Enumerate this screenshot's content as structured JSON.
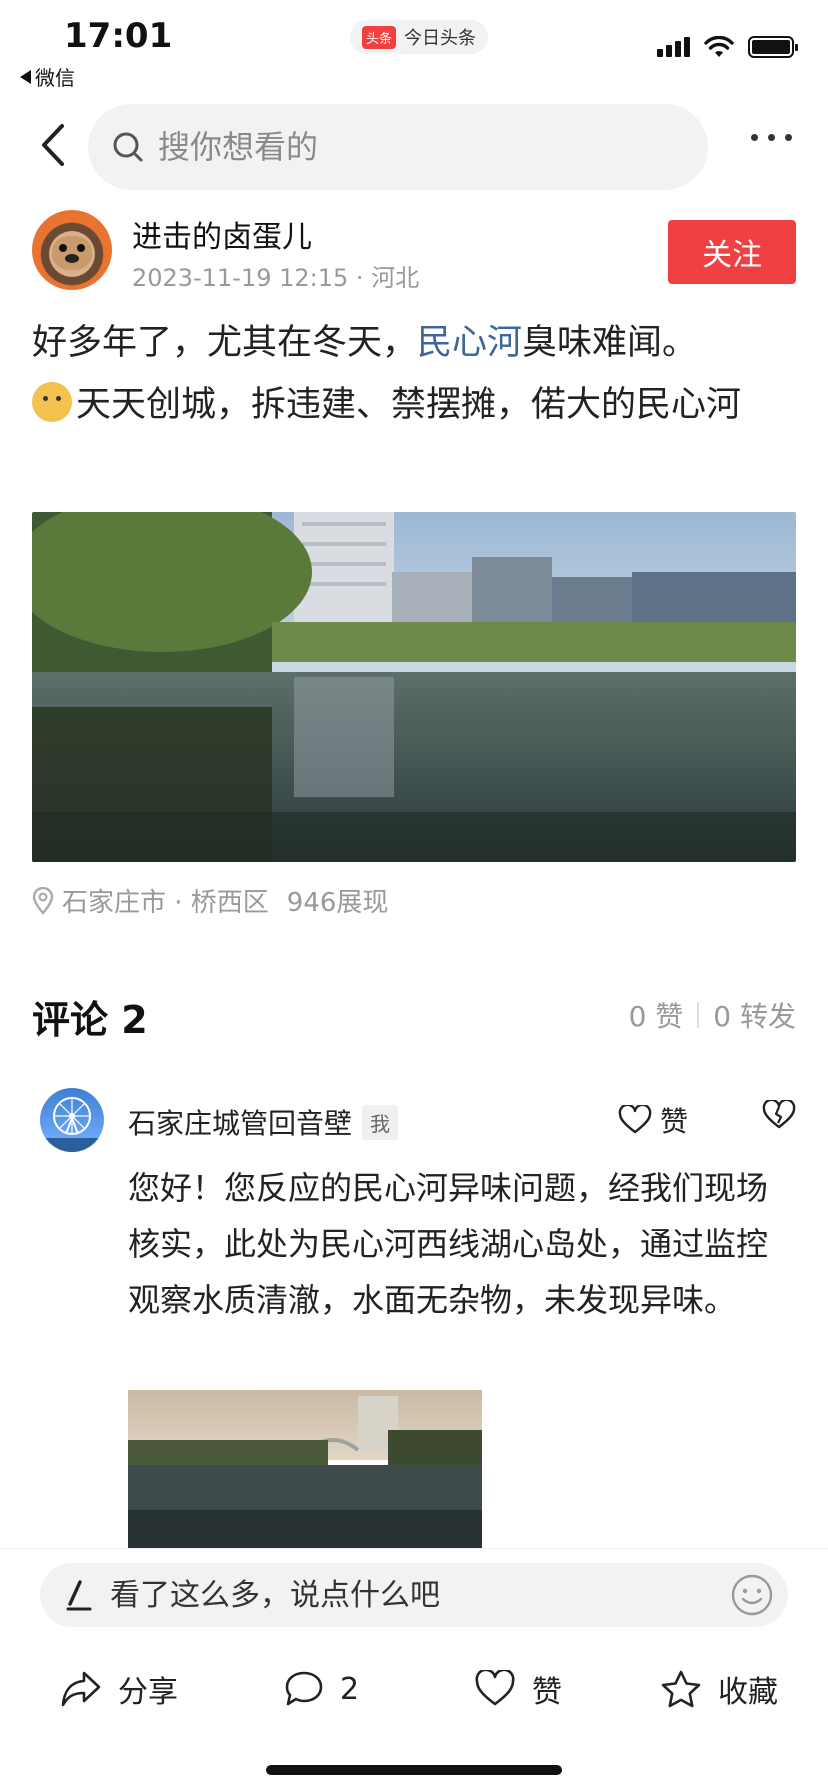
{
  "status_bar": {
    "time": "17:01",
    "back_app": "微信",
    "app_logo_text": "头条",
    "app_name": "今日头条"
  },
  "nav": {
    "search_placeholder": "搜你想看的"
  },
  "post": {
    "author": "进击的卤蛋儿",
    "timestamp": "2023-11-19 12:15",
    "region": "河北",
    "meta_sep": "·",
    "follow_label": "关注",
    "text_part1": "好多年了，尤其在冬天，",
    "text_link": "民心河",
    "text_part2": "臭味难闻。",
    "text_part3": "天天创城，拆违建、禁摆摊，偌大的民心河",
    "location": "石家庄市 · 桥西区",
    "views": "946展现"
  },
  "comments": {
    "title": "评论 2",
    "likes": "0 赞",
    "reposts": "0 转发",
    "items": [
      {
        "author": "石家庄城管回音壁",
        "badge": "我",
        "like_label": "赞",
        "text": "您好！您反应的民心河异味问题，经我们现场核实，此处为民心河西线湖心岛处，通过监控观察水质清澈，水面无杂物，未发现异味。"
      }
    ]
  },
  "bottom_bar": {
    "input_placeholder": "看了这么多，说点什么吧",
    "share_label": "分享",
    "comment_count": "2",
    "like_label": "赞",
    "favorite_label": "收藏"
  }
}
